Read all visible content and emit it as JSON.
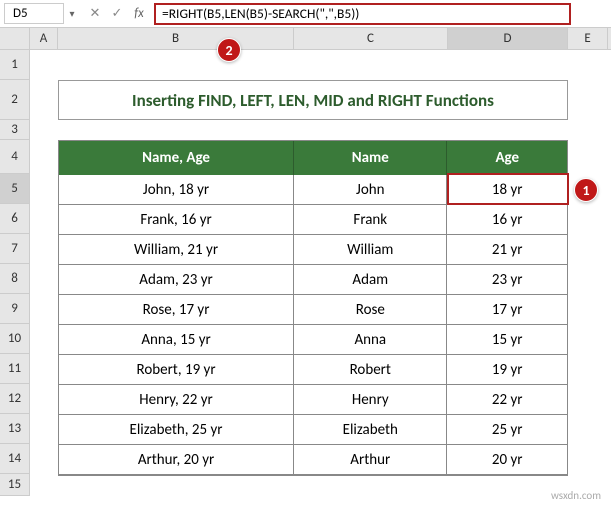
{
  "name_box": "D5",
  "formula": "=RIGHT(B5,LEN(B5)-SEARCH(\",\",B5))",
  "col_headers": [
    "A",
    "B",
    "C",
    "D",
    "E"
  ],
  "row_headers": [
    "1",
    "2",
    "3",
    "4",
    "5",
    "6",
    "7",
    "8",
    "9",
    "10",
    "11",
    "12",
    "13",
    "14",
    "15"
  ],
  "title": "Inserting FIND, LEFT, LEN, MID and RIGHT Functions",
  "table": {
    "headers": [
      "Name, Age",
      "Name",
      "Age"
    ],
    "rows": [
      [
        "John, 18 yr",
        "John",
        "18 yr"
      ],
      [
        "Frank, 16 yr",
        "Frank",
        "16 yr"
      ],
      [
        "William, 21 yr",
        "William",
        "21 yr"
      ],
      [
        "Adam, 23 yr",
        "Adam",
        "23 yr"
      ],
      [
        "Rose, 17 yr",
        "Rose",
        "17 yr"
      ],
      [
        "Anna, 15 yr",
        "Anna",
        "15 yr"
      ],
      [
        "Robert, 19 yr",
        "Robert",
        "19 yr"
      ],
      [
        "Henry, 22 yr",
        "Henry",
        "22 yr"
      ],
      [
        "Elizabeth, 25 yr",
        "Elizabeth",
        "25 yr"
      ],
      [
        "Arthur, 20 yr",
        "Arthur",
        "20 yr"
      ]
    ]
  },
  "badges": {
    "b1": "1",
    "b2": "2"
  },
  "watermark": "wsxdn.com"
}
